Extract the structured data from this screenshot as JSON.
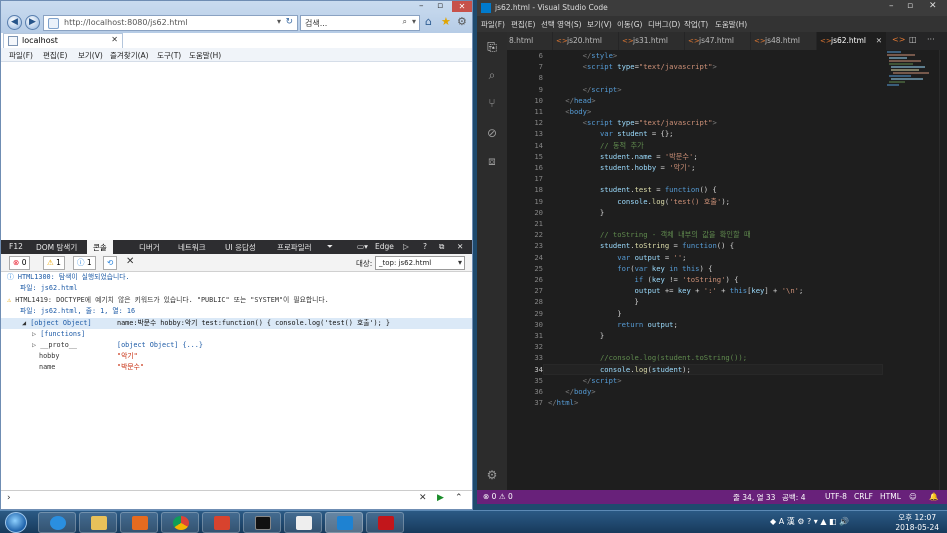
{
  "ie": {
    "address_url": "http://localhost:8080/js62.html",
    "search_placeholder": "검색...",
    "tab_title": "localhost",
    "menu": [
      "파일(F)",
      "편집(E)",
      "보기(V)",
      "즐겨찾기(A)",
      "도구(T)",
      "도움말(H)"
    ],
    "f12": {
      "tabs": [
        "F12",
        "DOM 탐색기",
        "콘솔",
        "디버거",
        "네트워크",
        "UI 응답성",
        "프로파일러",
        "Edge"
      ],
      "error_count": "0",
      "warning_count": "1",
      "info_count": "1",
      "target_label": "대상:",
      "target_value": "_top: js62.html",
      "messages": [
        {
          "code": "HTML1300:",
          "text": "탐색이 실행되었습니다.",
          "file": "파일: js62.html"
        },
        {
          "code": "HTML1419:",
          "text": "DOCTYPE에 예기치 않은 키워드가 있습니다. \"PUBLIC\" 또는 \"SYSTEM\"이 필요합니다.",
          "file": "파일: js62.html, 줄: 1, 열: 16"
        }
      ],
      "object_row": {
        "label": "[object Object]",
        "value": "name:박문수 hobby:악기 test:function() { console.log('test() 호출'); }"
      },
      "tree": [
        {
          "key": "[functions]",
          "value": ""
        },
        {
          "key": "__proto__",
          "value": "[object Object] {...}"
        },
        {
          "key": "hobby",
          "value": "\"악기\""
        },
        {
          "key": "name",
          "value": "\"박문수\""
        }
      ]
    }
  },
  "vscode": {
    "title": "js62.html - Visual Studio Code",
    "menu": [
      "파일(F)",
      "편집(E)",
      "선택 영역(S)",
      "보기(V)",
      "이동(G)",
      "디버그(D)",
      "작업(T)",
      "도움말(H)"
    ],
    "tabs": [
      "8.html",
      "js20.html",
      "js31.html",
      "js47.html",
      "js48.html",
      "js62.html"
    ],
    "active_tab": "js62.html",
    "line_numbers": [
      "6",
      "7",
      "8",
      "9",
      "10",
      "11",
      "12",
      "13",
      "14",
      "15",
      "16",
      "17",
      "18",
      "19",
      "20",
      "21",
      "22",
      "23",
      "24",
      "25",
      "26",
      "27",
      "28",
      "29",
      "30",
      "31",
      "32",
      "33",
      "34",
      "35",
      "36",
      "37"
    ],
    "status": {
      "errors": "0",
      "warnings": "0",
      "position": "줄 34, 열 33",
      "indent": "공백: 4",
      "encoding": "UTF-8",
      "eol": "CRLF",
      "language": "HTML"
    }
  },
  "taskbar": {
    "time": "오후 12:07",
    "date": "2018-05-24"
  }
}
